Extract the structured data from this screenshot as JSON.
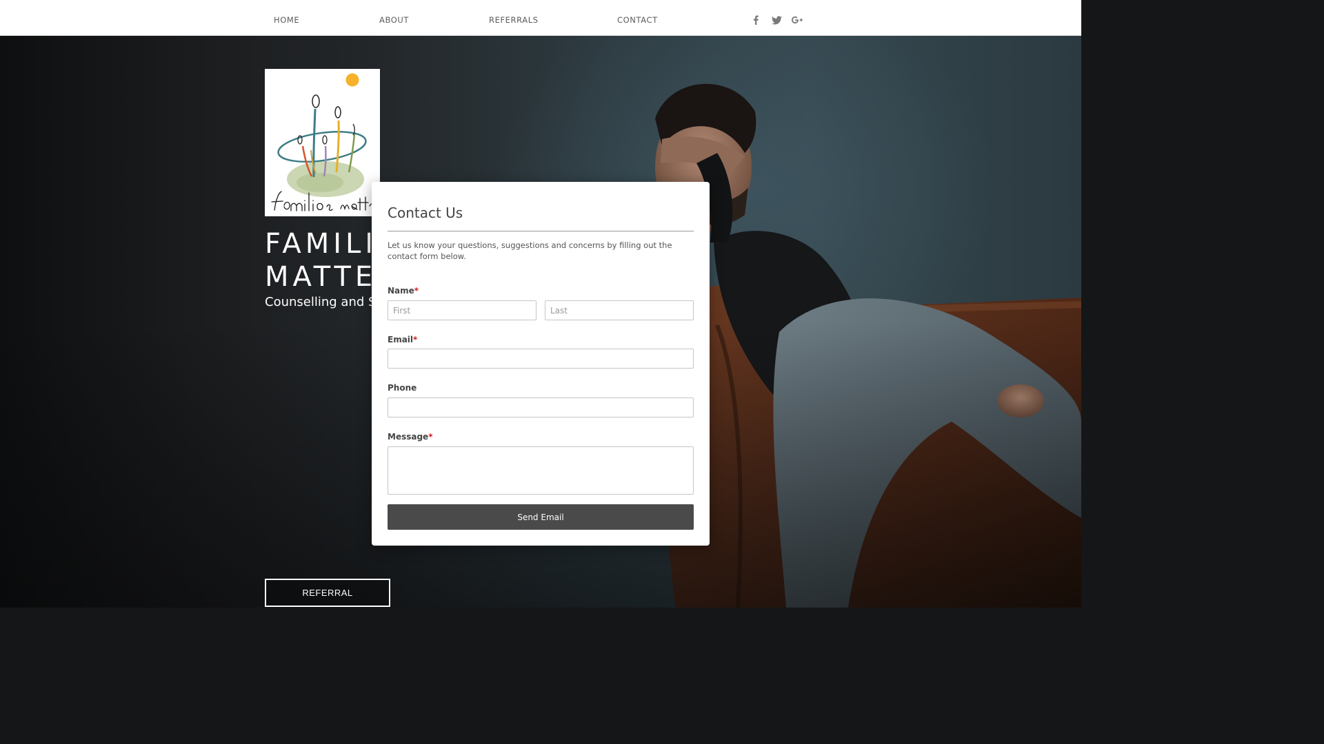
{
  "nav": {
    "items": [
      {
        "label": "HOME"
      },
      {
        "label": "ABOUT"
      },
      {
        "label": "REFERRALS"
      },
      {
        "label": "CONTACT"
      }
    ],
    "social": [
      "facebook-icon",
      "twitter-icon",
      "google-plus-icon"
    ]
  },
  "logo": {
    "script_text": "families matter",
    "colors": {
      "sun": "#F7B12A",
      "ring": "#3D7D85",
      "wash": "#B9C89A"
    }
  },
  "hero": {
    "title": "FAMILIES MATTER",
    "subtitle": "Counselling and Support",
    "referral_button": "REFERRAL"
  },
  "contact_form": {
    "title": "Contact Us",
    "intro": "Let us know your questions, suggestions and concerns by filling out the contact form below.",
    "name_label": "Name",
    "first_placeholder": "First",
    "last_placeholder": "Last",
    "email_label": "Email",
    "phone_label": "Phone",
    "message_label": "Message",
    "required_mark": "*",
    "submit_label": "Send Email"
  },
  "colors": {
    "accent_required": "#D21E1E",
    "button": "#4A4A4A",
    "nav_text": "#5A5A5A"
  }
}
